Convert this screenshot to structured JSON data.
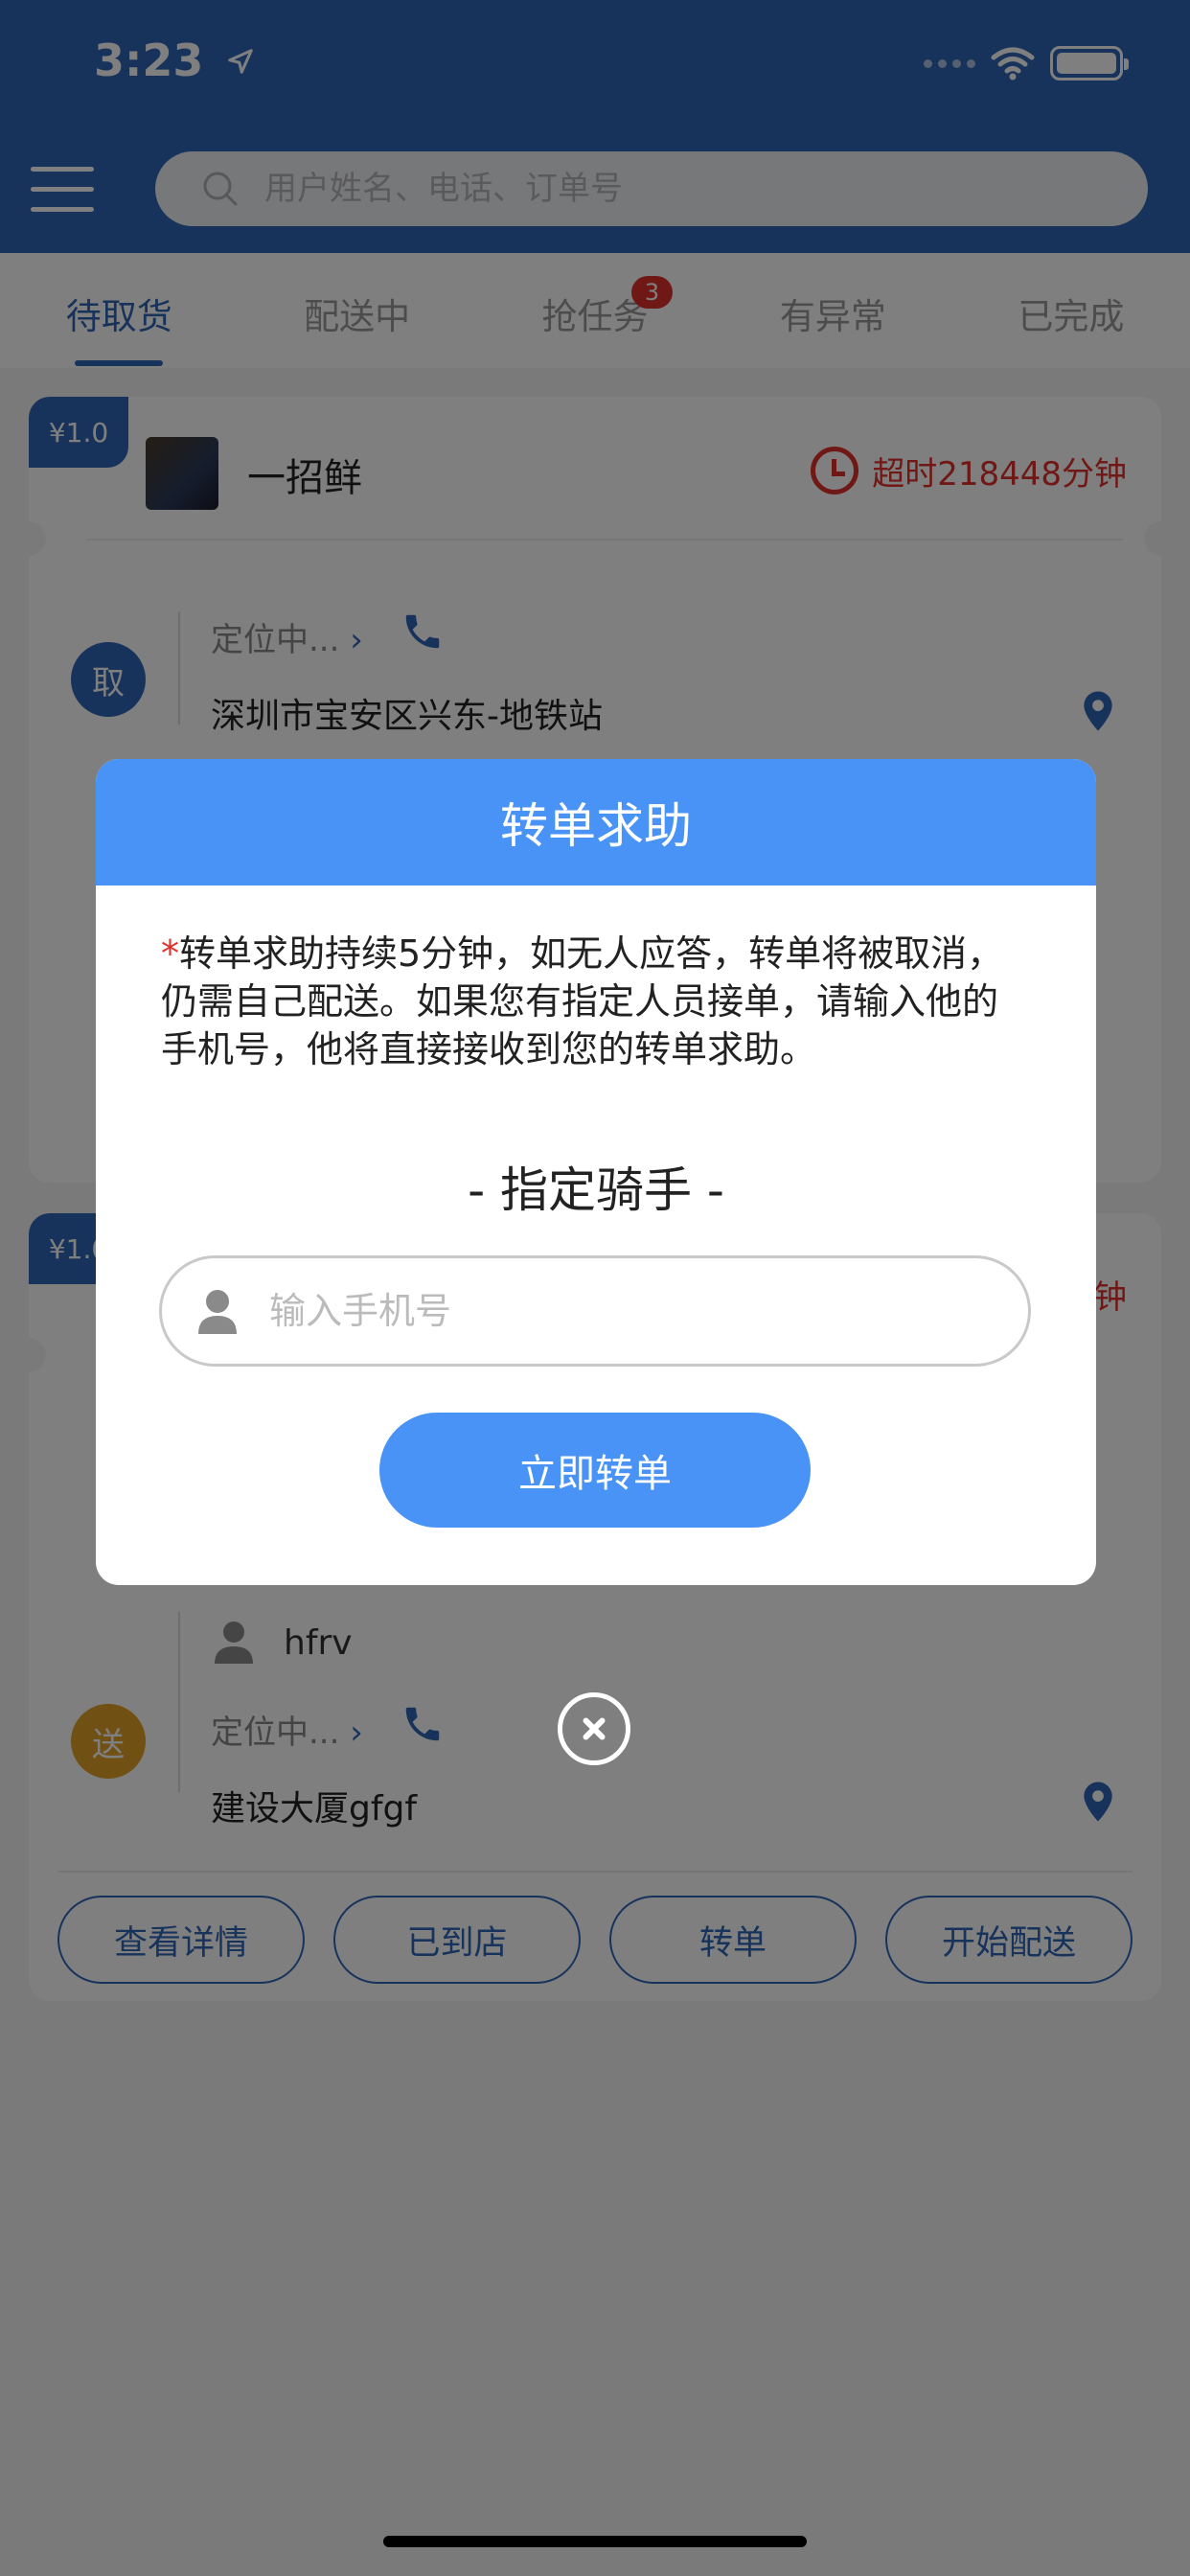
{
  "status_bar": {
    "time": "3:23"
  },
  "header": {
    "search_placeholder": "用户姓名、电话、订单号"
  },
  "tabs": [
    {
      "label": "待取货",
      "active": true
    },
    {
      "label": "配送中"
    },
    {
      "label": "抢任务",
      "badge": "3"
    },
    {
      "label": "有异常"
    },
    {
      "label": "已完成"
    }
  ],
  "orders": [
    {
      "price": "¥1.0",
      "shop": "一招鲜",
      "overtime": "超时218448分钟",
      "pickup": {
        "tag": "取",
        "locating": "定位中...",
        "address": "深圳市宝安区兴东-地铁站"
      }
    },
    {
      "price": "¥1.0",
      "overtime_suffix": "钟",
      "delivery": {
        "tag": "送",
        "name": "hfrv",
        "locating": "定位中...",
        "address": "建设大厦gfgf"
      },
      "actions": [
        "查看详情",
        "已到店",
        "转单",
        "开始配送"
      ]
    }
  ],
  "dialog": {
    "title": "转单求助",
    "required_mark": "*",
    "message": "转单求助持续5分钟，如无人应答，转单将被取消，仍需自己配送。如果您有指定人员接单，请输入他的手机号，他将直接接收到您的转单求助。",
    "subtitle": "- 指定骑手 -",
    "phone_placeholder": "输入手机号",
    "submit_label": "立即转单"
  },
  "colors": {
    "primary": "#2f66b6",
    "dialog_accent": "#4a93f6",
    "alert": "#e0302b",
    "send_tag": "#e3a028"
  }
}
